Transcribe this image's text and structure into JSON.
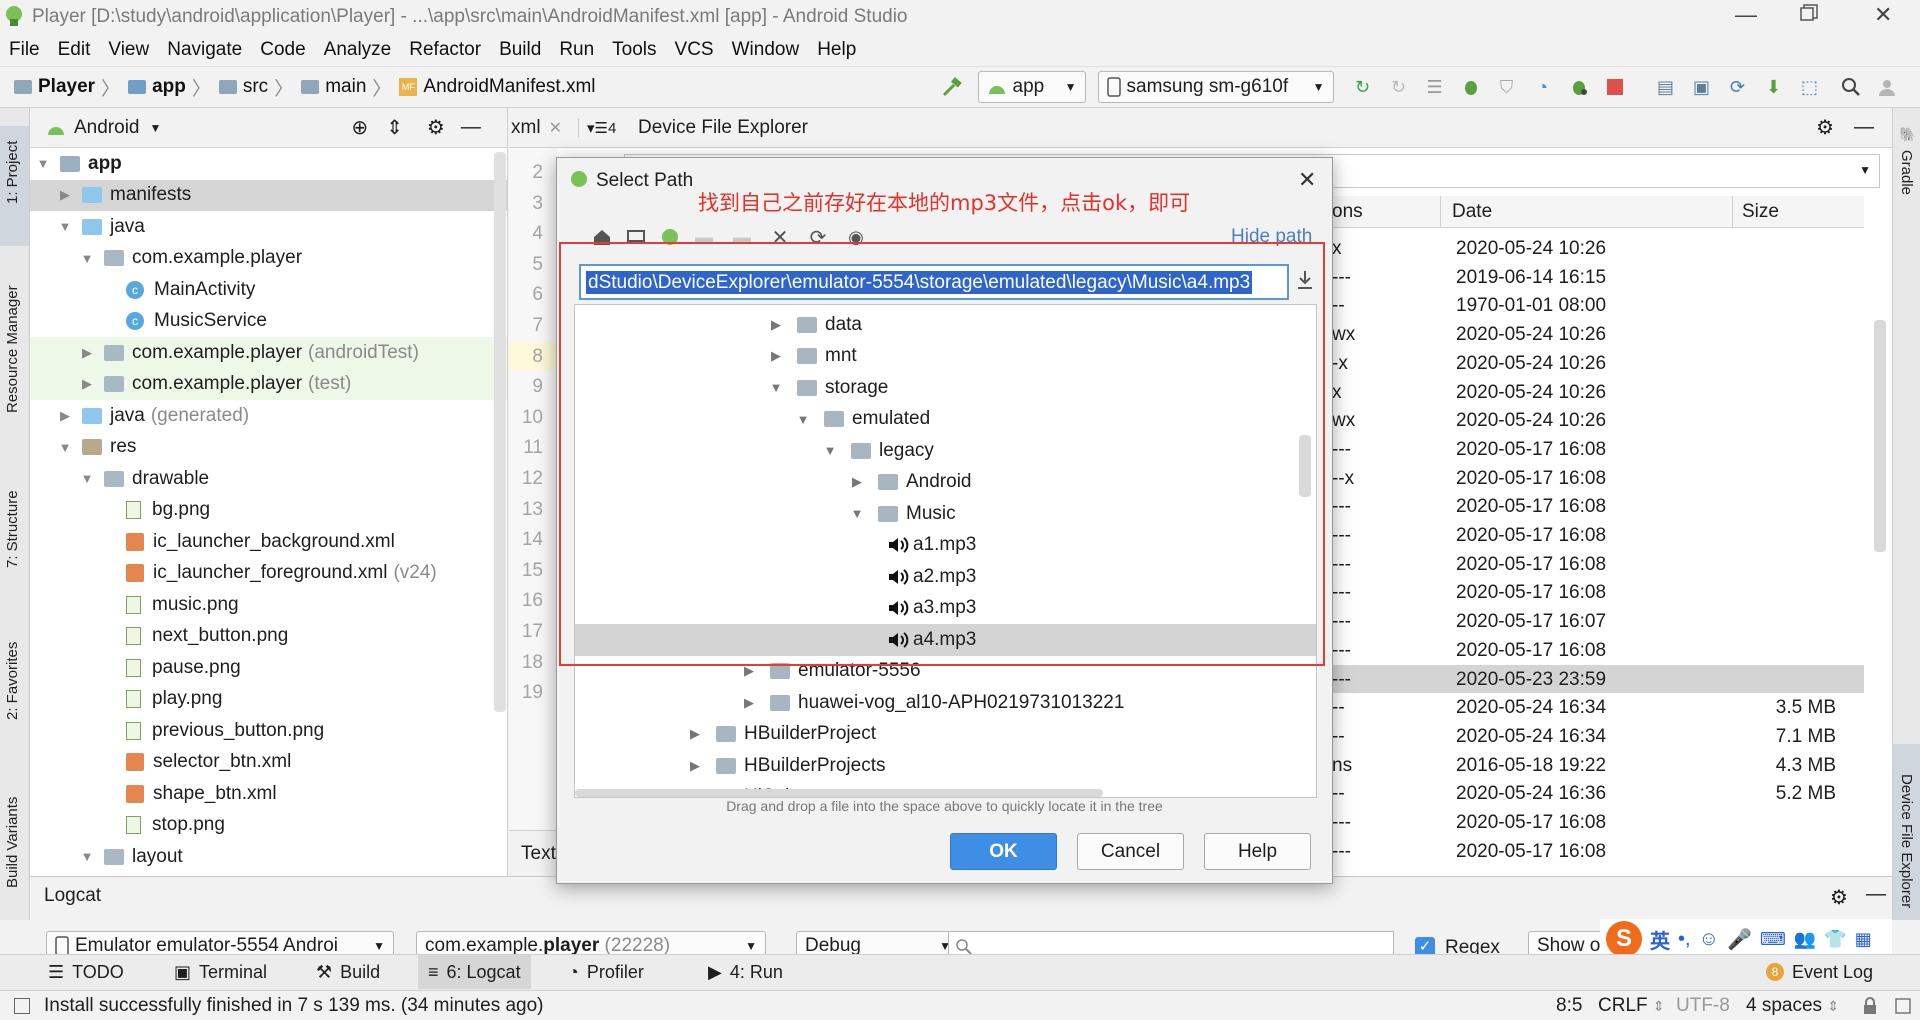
{
  "window": {
    "title": "Player [D:\\study\\android\\application\\Player] - ...\\app\\src\\main\\AndroidManifest.xml [app] - Android Studio"
  },
  "menu": [
    "File",
    "Edit",
    "View",
    "Navigate",
    "Code",
    "Analyze",
    "Refactor",
    "Build",
    "Run",
    "Tools",
    "VCS",
    "Window",
    "Help"
  ],
  "breadcrumb": [
    "Player",
    "app",
    "src",
    "main",
    "AndroidManifest.xml"
  ],
  "toolbar": {
    "config": "app",
    "device": "samsung sm-g610f"
  },
  "left_strip": [
    "1: Project",
    "Resource Manager",
    "7: Structure",
    "2: Favorites",
    "Build Variants"
  ],
  "right_strip": [
    "Gradle",
    "Device File Explorer"
  ],
  "project": {
    "view_label": "Android",
    "tree": [
      {
        "label": "app",
        "extra": "",
        "depth": 0,
        "expanded": true,
        "icon": "module",
        "bold": true
      },
      {
        "label": "manifests",
        "extra": "",
        "depth": 1,
        "expanded": false,
        "icon": "folder-blue"
      },
      {
        "label": "java",
        "extra": "",
        "depth": 1,
        "expanded": true,
        "icon": "folder-blue"
      },
      {
        "label": "com.example.player",
        "extra": "",
        "depth": 2,
        "expanded": true,
        "icon": "package"
      },
      {
        "label": "MainActivity",
        "extra": "",
        "depth": 3,
        "icon": "class"
      },
      {
        "label": "MusicService",
        "extra": "",
        "depth": 3,
        "icon": "class"
      },
      {
        "label": "com.example.player",
        "extra": "(androidTest)",
        "depth": 2,
        "expanded": false,
        "icon": "package"
      },
      {
        "label": "com.example.player",
        "extra": "(test)",
        "depth": 2,
        "expanded": false,
        "icon": "package"
      },
      {
        "label": "java",
        "extra": "(generated)",
        "depth": 1,
        "expanded": false,
        "icon": "folder-gen"
      },
      {
        "label": "res",
        "extra": "",
        "depth": 1,
        "expanded": true,
        "icon": "folder-res"
      },
      {
        "label": "drawable",
        "extra": "",
        "depth": 2,
        "expanded": true,
        "icon": "package"
      },
      {
        "label": "bg.png",
        "extra": "",
        "depth": 3,
        "icon": "image"
      },
      {
        "label": "ic_launcher_background.xml",
        "extra": "",
        "depth": 3,
        "icon": "xml"
      },
      {
        "label": "ic_launcher_foreground.xml",
        "extra": "(v24)",
        "depth": 3,
        "icon": "xml"
      },
      {
        "label": "music.png",
        "extra": "",
        "depth": 3,
        "icon": "image"
      },
      {
        "label": "next_button.png",
        "extra": "",
        "depth": 3,
        "icon": "image"
      },
      {
        "label": "pause.png",
        "extra": "",
        "depth": 3,
        "icon": "image"
      },
      {
        "label": "play.png",
        "extra": "",
        "depth": 3,
        "icon": "image"
      },
      {
        "label": "previous_button.png",
        "extra": "",
        "depth": 3,
        "icon": "image"
      },
      {
        "label": "selector_btn.xml",
        "extra": "",
        "depth": 3,
        "icon": "xml"
      },
      {
        "label": "shape_btn.xml",
        "extra": "",
        "depth": 3,
        "icon": "xml"
      },
      {
        "label": "stop.png",
        "extra": "",
        "depth": 3,
        "icon": "image"
      },
      {
        "label": "layout",
        "extra": "",
        "depth": 2,
        "expanded": true,
        "icon": "package"
      }
    ]
  },
  "editor": {
    "tab": "xml",
    "tab_count": "4",
    "line_numbers": [
      "2",
      "3",
      "4",
      "5",
      "6",
      "7",
      "8",
      "9",
      "10",
      "11",
      "12",
      "13",
      "14",
      "15",
      "16",
      "17",
      "18",
      "19"
    ],
    "bottom_tab": "Text"
  },
  "device_explorer": {
    "title": "Device File Explorer",
    "columns": [
      "ons",
      "Date",
      "Size"
    ],
    "rows": [
      {
        "perm": "x",
        "date": "2020-05-24 10:26",
        "size": ""
      },
      {
        "perm": "---",
        "date": "2019-06-14 16:15",
        "size": ""
      },
      {
        "perm": "--",
        "date": "1970-01-01 08:00",
        "size": ""
      },
      {
        "perm": "wx",
        "date": "2020-05-24 10:26",
        "size": ""
      },
      {
        "perm": "-x",
        "date": "2020-05-24 10:26",
        "size": ""
      },
      {
        "perm": "x",
        "date": "2020-05-24 10:26",
        "size": ""
      },
      {
        "perm": "wx",
        "date": "2020-05-24 10:26",
        "size": ""
      },
      {
        "perm": "---",
        "date": "2020-05-17 16:08",
        "size": ""
      },
      {
        "perm": "--x",
        "date": "2020-05-17 16:08",
        "size": ""
      },
      {
        "perm": "---",
        "date": "2020-05-17 16:08",
        "size": ""
      },
      {
        "perm": "---",
        "date": "2020-05-17 16:08",
        "size": ""
      },
      {
        "perm": "---",
        "date": "2020-05-17 16:08",
        "size": ""
      },
      {
        "perm": "---",
        "date": "2020-05-17 16:08",
        "size": ""
      },
      {
        "perm": "---",
        "date": "2020-05-17 16:07",
        "size": ""
      },
      {
        "perm": "---",
        "date": "2020-05-17 16:08",
        "size": ""
      },
      {
        "perm": "---",
        "date": "2020-05-23 23:59",
        "size": "",
        "selected": true
      },
      {
        "perm": "--",
        "date": "2020-05-24 16:34",
        "size": "3.5 MB"
      },
      {
        "perm": "--",
        "date": "2020-05-24 16:34",
        "size": "7.1 MB"
      },
      {
        "perm": "ns",
        "date": "2016-05-18 19:22",
        "size": "4.3 MB"
      },
      {
        "perm": "--",
        "date": "2020-05-24 16:36",
        "size": "5.2 MB"
      },
      {
        "perm": "---",
        "date": "2020-05-17 16:08",
        "size": ""
      },
      {
        "perm": "---",
        "date": "2020-05-17 16:08",
        "size": ""
      }
    ]
  },
  "dialog": {
    "title": "Select Path",
    "annotation": "找到自己之前存好在本地的mp3文件，点击ok，即可",
    "hide_path": "Hide path",
    "path": "dStudio\\DeviceExplorer\\emulator-5554\\storage\\emulated\\legacy\\Music\\a4.mp3",
    "tree": [
      {
        "label": "data",
        "depth": 0,
        "expanded": false,
        "type": "folder"
      },
      {
        "label": "mnt",
        "depth": 0,
        "expanded": false,
        "type": "folder"
      },
      {
        "label": "storage",
        "depth": 0,
        "expanded": true,
        "type": "folder"
      },
      {
        "label": "emulated",
        "depth": 1,
        "expanded": true,
        "type": "folder"
      },
      {
        "label": "legacy",
        "depth": 2,
        "expanded": true,
        "type": "folder"
      },
      {
        "label": "Android",
        "depth": 3,
        "expanded": false,
        "type": "folder"
      },
      {
        "label": "Music",
        "depth": 3,
        "expanded": true,
        "type": "folder"
      },
      {
        "label": "a1.mp3",
        "depth": 4,
        "type": "audio"
      },
      {
        "label": "a2.mp3",
        "depth": 4,
        "type": "audio"
      },
      {
        "label": "a3.mp3",
        "depth": 4,
        "type": "audio"
      },
      {
        "label": "a4.mp3",
        "depth": 4,
        "type": "audio",
        "selected": true
      },
      {
        "label": "emulator-5556",
        "depth": -1,
        "expanded": false,
        "type": "folder"
      },
      {
        "label": "huawei-vog_al10-APH0219731013221",
        "depth": -1,
        "expanded": false,
        "type": "folder"
      },
      {
        "label": "HBuilderProject",
        "depth": -2,
        "expanded": false,
        "type": "folder"
      },
      {
        "label": "HBuilderProjects",
        "depth": -2,
        "expanded": false,
        "type": "folder"
      },
      {
        "label": "HiSuite",
        "depth": -2,
        "expanded": false,
        "type": "folder"
      }
    ],
    "hint": "Drag and drop a file into the space above to quickly locate it in the tree",
    "ok": "OK",
    "cancel": "Cancel",
    "help": "Help"
  },
  "logcat": {
    "title": "Logcat",
    "device": "Emulator emulator-5554 Androi",
    "process_prefix": "com.example.",
    "process_bold": "player",
    "process_pid": "(22228)",
    "level": "Debug",
    "regex_label": "Regex",
    "show_only": "Show onl",
    "ime_label": "英"
  },
  "bottom_tabs": [
    {
      "icon": "list-icon",
      "label": "TODO"
    },
    {
      "icon": "terminal-icon",
      "label": "Terminal"
    },
    {
      "icon": "hammer-icon",
      "label": "Build"
    },
    {
      "icon": "logcat-icon",
      "label": "6: Logcat",
      "active": true
    },
    {
      "icon": "profiler-icon",
      "label": "Profiler"
    },
    {
      "icon": "run-icon",
      "label": "4: Run"
    }
  ],
  "event_log": {
    "count": "8",
    "label": "Event Log"
  },
  "status": {
    "message": "Install successfully finished in 7 s 139 ms. (34 minutes ago)",
    "position": "8:5",
    "line_sep": "CRLF",
    "encoding": "UTF-8",
    "indent": "4 spaces"
  },
  "colors": {
    "accent": "#3f8ee5",
    "selection": "#2f65ca",
    "annotation_red": "#e5312a",
    "android_green": "#78c257",
    "folder_blue": "#8fc6ec"
  }
}
